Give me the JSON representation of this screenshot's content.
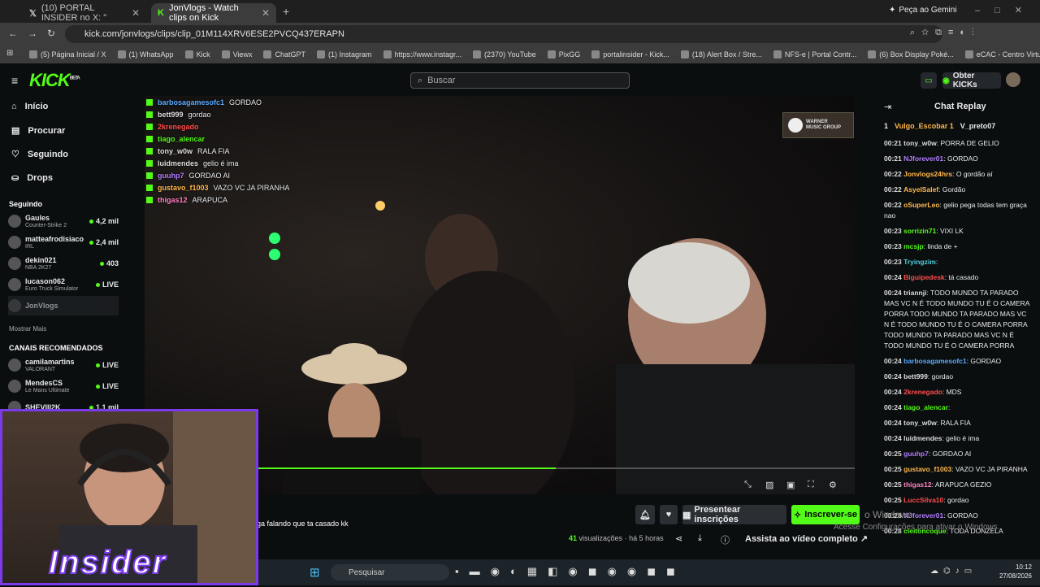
{
  "browser": {
    "tabs": [
      {
        "title": "(10) PORTAL INSIDER no X: \"",
        "active": false
      },
      {
        "title": "JonVlogs - Watch clips on Kick",
        "active": true
      }
    ],
    "new_tab": "+",
    "gemini": "Peça ao Gemini",
    "url": "kick.com/jonvlogs/clips/clip_01M114XRV6ESE2PVCQ437ERAPN",
    "bookmarks": [
      "(5) Página Inicial / X",
      "(1) WhatsApp",
      "Kick",
      "Viewx",
      "ChatGPT",
      "(1) Instagram",
      "https://www.instagr...",
      "(2370) YouTube",
      "PixGG",
      "portalinsider - Kick...",
      "(18) Alert Box / Stre...",
      "NFS-e | Portal Contr...",
      "(6) Box Display Poké...",
      "eCAC - Centro Virtu..."
    ]
  },
  "header": {
    "logo": "KICK",
    "logo_badge": "BETA",
    "search_placeholder": "Buscar",
    "kicks_button": "Obter KICKs"
  },
  "sidebar": {
    "nav": [
      {
        "label": "Início",
        "icon": "home-icon"
      },
      {
        "label": "Procurar",
        "icon": "browse-icon"
      },
      {
        "label": "Seguindo",
        "icon": "heart-icon"
      },
      {
        "label": "Drops",
        "icon": "drops-icon"
      }
    ],
    "following_title": "Seguindo",
    "following": [
      {
        "name": "Gaules",
        "game": "Counter-Strike 2",
        "viewers": "4,2 mil"
      },
      {
        "name": "matteafrodisiaco",
        "game": "IRL",
        "viewers": "2,4 mil"
      },
      {
        "name": "dekin021",
        "game": "NBA 2K27",
        "viewers": "403"
      },
      {
        "name": "lucason062",
        "game": "Euro Truck Simulator",
        "viewers": "LIVE"
      },
      {
        "name": "JonVlogs",
        "game": "",
        "viewers": ""
      }
    ],
    "show_more": "Mostrar Mais",
    "recommended_title": "CANAIS RECOMENDADOS",
    "recommended": [
      {
        "name": "camilamartins",
        "game": "VALORANT",
        "viewers": "LIVE"
      },
      {
        "name": "MendesCS",
        "game": "Le Mans Ultimate",
        "viewers": "LIVE"
      },
      {
        "name": "SHEVIII2K",
        "game": "",
        "viewers": "1,1 mil"
      }
    ]
  },
  "overlay_chat": [
    {
      "user": "barbosagamesofc1",
      "text": "GORDAO",
      "color": "#5aa9ff"
    },
    {
      "user": "bett999",
      "text": "gordao",
      "color": "#dddddd"
    },
    {
      "user": "2krenegado",
      "text": "",
      "color": "#ff4d4d"
    },
    {
      "user": "tiago_alencar",
      "text": "",
      "color": "#53fc18"
    },
    {
      "user": "tony_w0w",
      "text": "RALA FIA",
      "color": "#dddddd"
    },
    {
      "user": "luidmendes",
      "text": "gelio é ima",
      "color": "#dddddd"
    },
    {
      "user": "guuhp7",
      "text": "GORDAO AI",
      "color": "#b37cff"
    },
    {
      "user": "gustavo_f1003",
      "text": "VAZO VC JA PIRANHA",
      "color": "#ffb84d"
    },
    {
      "user": "thigas12",
      "text": "ARAPUCA",
      "color": "#ff80c0"
    }
  ],
  "video": {
    "sponsor": "WARNER MUSIC GROUP",
    "progress": 0.5
  },
  "below_video": {
    "title": "ga falando que ta casado kk",
    "present_subs": "Presentear inscrições",
    "subscribe": "Inscrever-se",
    "views_count": "41",
    "views_label": "visualizações",
    "time": "há 5 horas",
    "watch_full": "Assista ao vídeo completo"
  },
  "chat": {
    "title": "Chat Replay",
    "pinned": [
      "1",
      "Vulgo_Escobar 1",
      "V_preto07"
    ],
    "messages": [
      {
        "time": "00:21",
        "user": "tony_w0w",
        "text": "PORRA DE GELIO",
        "color": "#dddddd"
      },
      {
        "time": "00:21",
        "user": "NJforever01",
        "text": "GORDAO",
        "color": "#b37cff"
      },
      {
        "time": "00:22",
        "user": "Jonvlogs24hrs",
        "text": "O gordão aí",
        "color": "#ffb84d"
      },
      {
        "time": "00:22",
        "user": "AsyelSalef",
        "text": "Gordão",
        "color": "#ffb84d"
      },
      {
        "time": "00:22",
        "user": "oSuperLeo",
        "text": "gelio pega todas tem graça nao",
        "color": "#ffb84d"
      },
      {
        "time": "00:23",
        "user": "sorrizin71",
        "text": "VIXI LK",
        "color": "#53fc18"
      },
      {
        "time": "00:23",
        "user": "mcsjp",
        "text": "linda de +",
        "color": "#53fc18"
      },
      {
        "time": "00:23",
        "user": "Tryingzim",
        "text": "",
        "color": "#4dd0e1"
      },
      {
        "time": "00:24",
        "user": "Biguipedesk",
        "text": "tá casado",
        "color": "#ff4d4d"
      },
      {
        "time": "00:24",
        "user": "triannji",
        "text": "TODO MUNDO TA PARADO MAS VC N É TODO MUNDO TU É O CAMERA PORRA TODO MUNDO TA PARADO MAS VC N É TODO MUNDO TU É O CAMERA PORRA TODO MUNDO TA PARADO MAS VC N É TODO MUNDO TU É O CAMERA PORRA",
        "color": "#dddddd"
      },
      {
        "time": "00:24",
        "user": "barbosagamesofc1",
        "text": "GORDAO",
        "color": "#5aa9ff"
      },
      {
        "time": "00:24",
        "user": "bett999",
        "text": "gordao",
        "color": "#dddddd"
      },
      {
        "time": "00:24",
        "user": "2krenegado",
        "text": "MDS",
        "color": "#ff4d4d"
      },
      {
        "time": "00:24",
        "user": "tiago_alencar",
        "text": "",
        "color": "#53fc18"
      },
      {
        "time": "00:24",
        "user": "tony_w0w",
        "text": "RALA FIA",
        "color": "#dddddd"
      },
      {
        "time": "00:24",
        "user": "luidmendes",
        "text": "gelio é ima",
        "color": "#dddddd"
      },
      {
        "time": "00:25",
        "user": "guuhp7",
        "text": "GORDAO AI",
        "color": "#b37cff"
      },
      {
        "time": "00:25",
        "user": "gustavo_f1003",
        "text": "VAZO VC JA PIRANHA",
        "color": "#ffb84d"
      },
      {
        "time": "00:25",
        "user": "thigas12",
        "text": "ARAPUCA GEZIO",
        "color": "#ff80c0"
      },
      {
        "time": "00:25",
        "user": "LuccSilva10",
        "text": "gordao",
        "color": "#ff4d4d"
      },
      {
        "time": "00:28",
        "user": "NJforever01",
        "text": "GORDAO",
        "color": "#b37cff"
      },
      {
        "time": "00:28",
        "user": "cleitoncoque",
        "text": "TODA DONZELA",
        "color": "#53fc18"
      }
    ]
  },
  "stream_overlay": {
    "logo": "Insider"
  },
  "windows": {
    "activation_title": "o Windows",
    "activation_text": "Acesse Configurações para ativar o Windows.",
    "search": "Pesquisar",
    "time": "10:12",
    "date": "27/08/2026"
  }
}
